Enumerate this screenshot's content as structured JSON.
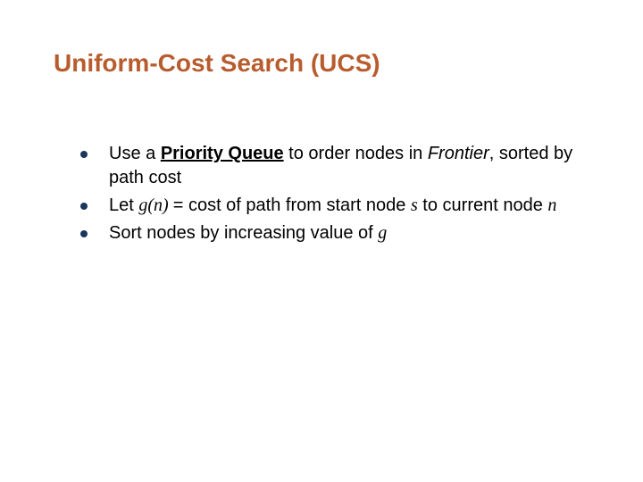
{
  "title": "Uniform-Cost Search (UCS)",
  "bullets": [
    {
      "prefix": "Use a ",
      "bold_underline": "Priority Queue",
      "mid1": " to order nodes in ",
      "ital1": "Frontier",
      "suffix1": ", sorted by path cost"
    },
    {
      "prefix2": "Let ",
      "serif1": "g",
      "serif2": "(",
      "serif3": "n",
      "serif4": ") ",
      "mid2": "= cost of path from start node ",
      "serif5": "s",
      "mid3": " to current node ",
      "serif6": "n"
    },
    {
      "text3a": "Sort nodes by increasing value of ",
      "serif7": "g"
    }
  ]
}
